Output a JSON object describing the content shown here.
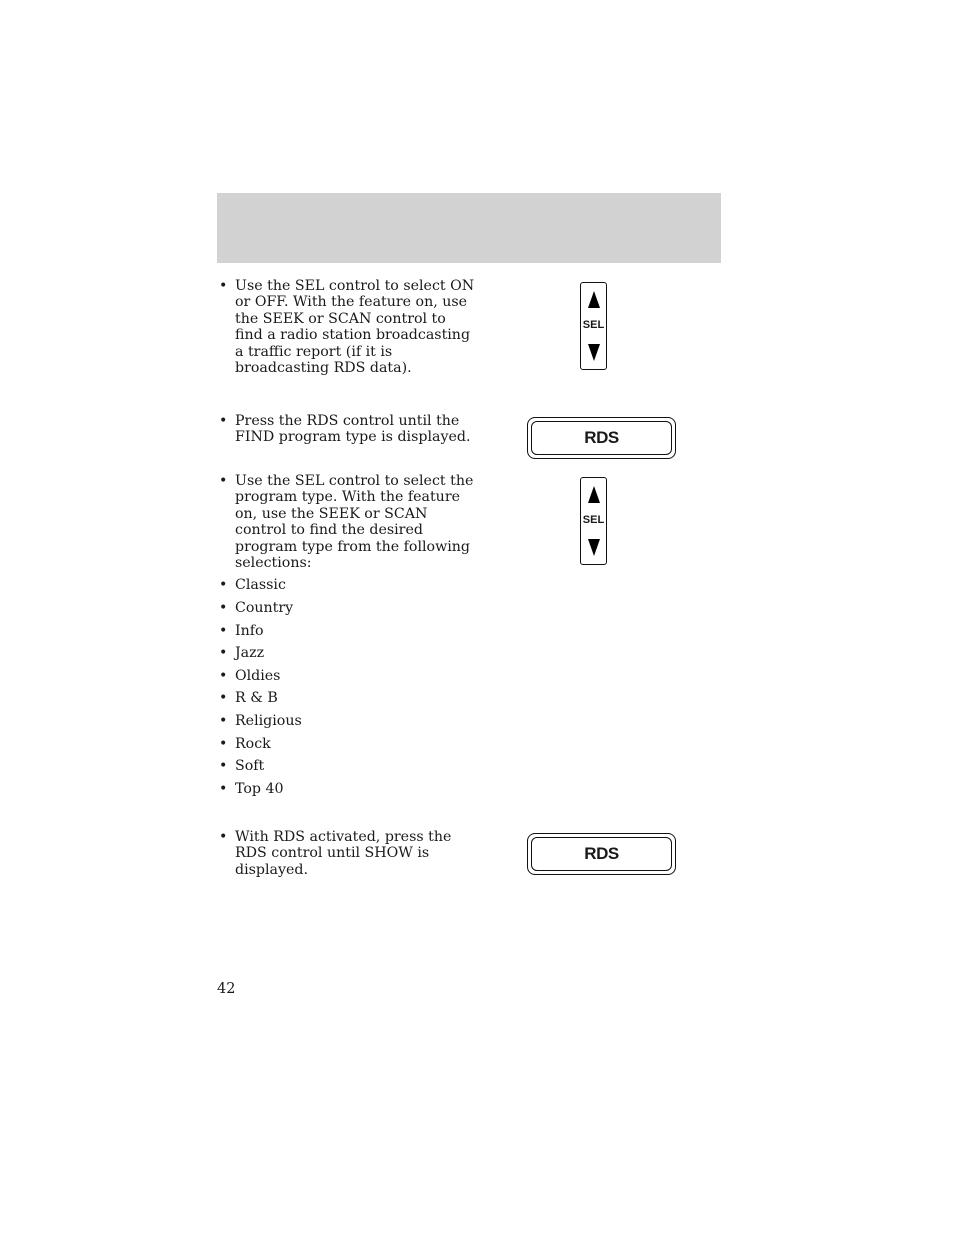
{
  "page": {
    "number": "42",
    "header_color": "#d2d2d2"
  },
  "sections": [
    {
      "text": "Use the SEL control to select ON or OFF. With the feature on, use the SEEK or SCAN control to find a radio station broadcasting a traffic report (if it is broadcasting RDS data).",
      "illustration": {
        "type": "sel-control",
        "label": "SEL"
      }
    },
    {
      "text": "Press the RDS control until the FIND program type is displayed.",
      "illustration": {
        "type": "rds-button",
        "label": "RDS"
      }
    },
    {
      "text": "Use the SEL control to select the program type. With the feature on, use the SEEK or SCAN control to find the desired program type from the following selections:",
      "illustration": {
        "type": "sel-control",
        "label": "SEL"
      }
    },
    {
      "text": "With RDS activated, press the RDS control until SHOW is displayed.",
      "illustration": {
        "type": "rds-button",
        "label": "RDS"
      }
    }
  ],
  "bullet_glyph": "•",
  "program_types": [
    "Classic",
    "Country",
    "Info",
    "Jazz",
    "Oldies",
    "R & B",
    "Religious",
    "Rock",
    "Soft",
    "Top 40"
  ]
}
